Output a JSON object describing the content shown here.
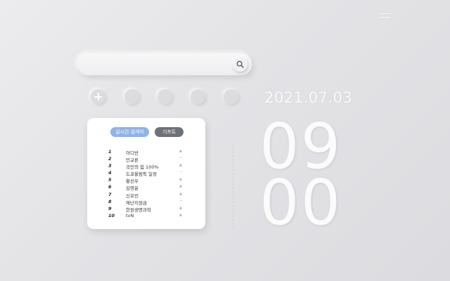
{
  "menu": {
    "icon": "hamburger-icon"
  },
  "search": {
    "placeholder": "",
    "value": "",
    "icon": "search-icon"
  },
  "shortcuts": [
    {
      "type": "add",
      "icon": "plus-icon"
    },
    {
      "type": "empty"
    },
    {
      "type": "empty"
    },
    {
      "type": "empty"
    },
    {
      "type": "empty"
    }
  ],
  "trending": {
    "tabs": [
      {
        "label": "실시간 검색어",
        "active": true
      },
      {
        "label": "기프트",
        "active": false
      }
    ],
    "items": [
      {
        "rank": "1",
        "keyword": "아디반",
        "trend": "▲"
      },
      {
        "rank": "2",
        "keyword": "민교론",
        "trend": "—"
      },
      {
        "rank": "3",
        "keyword": "국민의 힘 100%",
        "trend": "▲"
      },
      {
        "rank": "4",
        "keyword": "도쿄올림픽 일정",
        "trend": "—"
      },
      {
        "rank": "5",
        "keyword": "황선우",
        "trend": "▲"
      },
      {
        "rank": "6",
        "keyword": "김영윤",
        "trend": "▲"
      },
      {
        "rank": "7",
        "keyword": "신유빈",
        "trend": "▲"
      },
      {
        "rank": "8",
        "keyword": "재난지원금",
        "trend": "—"
      },
      {
        "rank": "9",
        "keyword": "한원생명과학",
        "trend": "▲"
      },
      {
        "rank": "10",
        "keyword": "tvN",
        "trend": "▲"
      }
    ]
  },
  "clock": {
    "date": "2021.07.03",
    "hours": "09",
    "minutes": "00"
  },
  "colors": {
    "active_tab": "#8fb2e8",
    "inactive_tab": "#6d7278"
  }
}
